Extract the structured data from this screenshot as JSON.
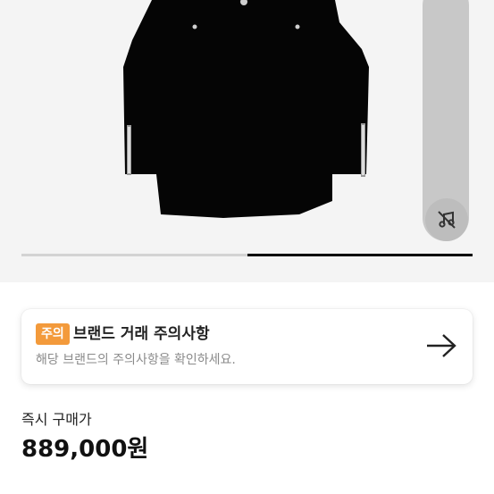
{
  "product": {
    "image_alt": "black zip-sleeve jacket",
    "gallery_progress": 0.5
  },
  "notice": {
    "badge": "주의",
    "title": "브랜드 거래 주의사항",
    "subtitle": "해당 브랜드의 주의사항을 확인하세요.",
    "badge_color": "#f39a3b"
  },
  "purchase": {
    "label": "즉시 구매가",
    "price": "889,000원"
  },
  "icons": {
    "mute": "sound-off-icon",
    "arrow": "arrow-right-icon"
  }
}
